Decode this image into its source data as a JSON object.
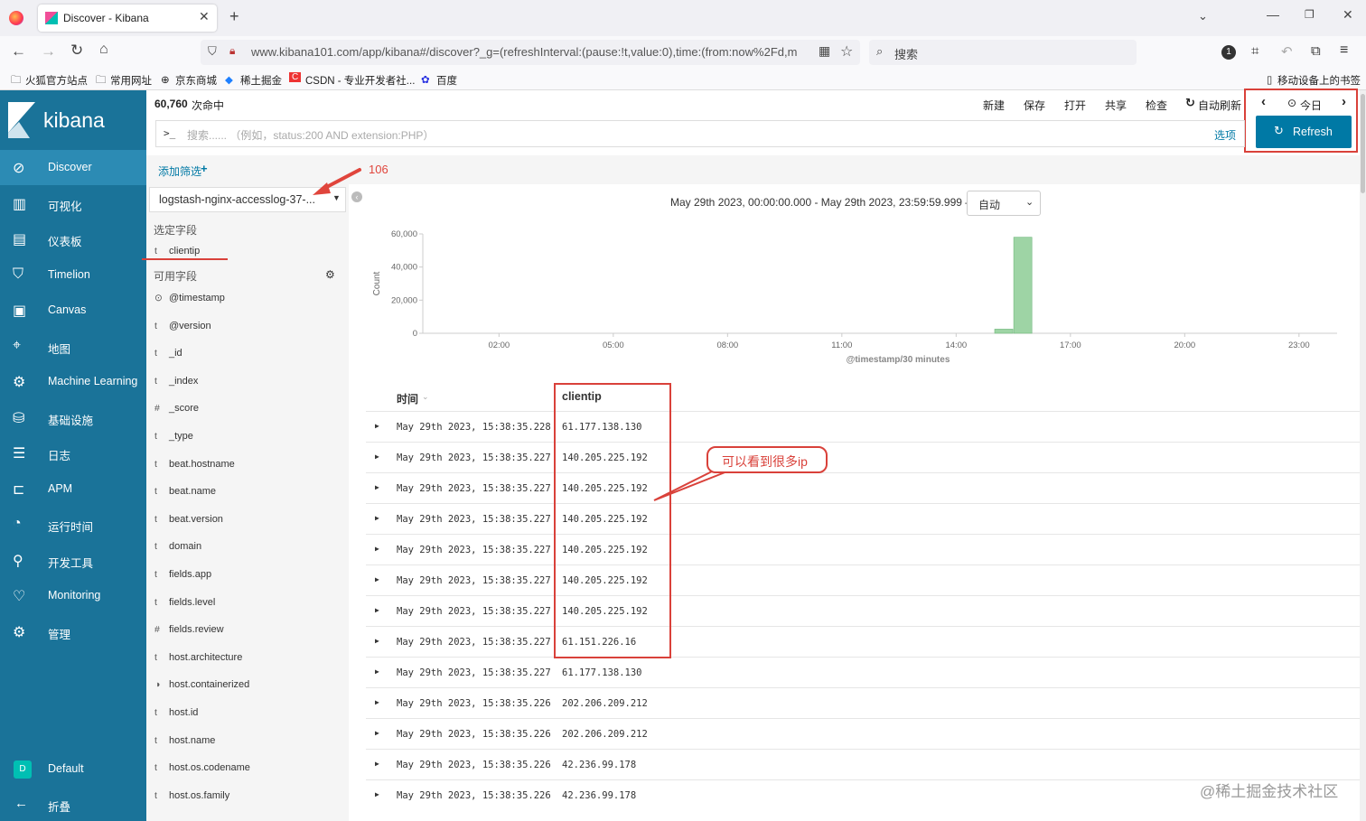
{
  "browser": {
    "tab_title": "Discover - Kibana",
    "url": "www.kibana101.com/app/kibana#/discover?_g=(refreshInterval:(pause:!t,value:0),time:(from:now%2Fd,m",
    "search_placeholder": "搜索",
    "bookmarks": [
      "火狐官方站点",
      "常用网址",
      "京东商城",
      "稀土掘金",
      "CSDN - 专业开发者社...",
      "百度"
    ],
    "mobile_bookmarks": "移动设备上的书签"
  },
  "kibana": {
    "logo_text": "kibana",
    "nav": [
      {
        "label": "Discover",
        "icon": "compass-icon"
      },
      {
        "label": "可视化",
        "icon": "chart-icon"
      },
      {
        "label": "仪表板",
        "icon": "dashboard-icon"
      },
      {
        "label": "Timelion",
        "icon": "shield-icon"
      },
      {
        "label": "Canvas",
        "icon": "canvas-icon"
      },
      {
        "label": "地图",
        "icon": "map-icon"
      },
      {
        "label": "Machine Learning",
        "icon": "ml-icon"
      },
      {
        "label": "基础设施",
        "icon": "infrastructure-icon"
      },
      {
        "label": "日志",
        "icon": "logs-icon"
      },
      {
        "label": "APM",
        "icon": "apm-icon"
      },
      {
        "label": "运行时间",
        "icon": "uptime-icon"
      },
      {
        "label": "开发工具",
        "icon": "wrench-icon"
      },
      {
        "label": "Monitoring",
        "icon": "heartbeat-icon"
      },
      {
        "label": "管理",
        "icon": "gear-icon"
      }
    ],
    "space": {
      "badge": "D",
      "label": "Default"
    },
    "collapse": "折叠",
    "hits_count": "60,760",
    "hits_label": "次命中",
    "top_actions": [
      "新建",
      "保存",
      "打开",
      "共享",
      "检查"
    ],
    "auto_refresh": "自动刷新",
    "today": "今日",
    "query_prompt": ">_",
    "query_placeholder": "搜索...... （例如，status:200 AND extension:PHP）",
    "options": "选项",
    "refresh": "Refresh",
    "add_filter": "添加筛选",
    "index_pattern": "logstash-nginx-accesslog-37-...",
    "selected_fields_title": "选定字段",
    "selected_fields": [
      {
        "type": "t",
        "name": "clientip"
      }
    ],
    "available_fields_title": "可用字段",
    "available_fields": [
      {
        "type": "clock",
        "name": "@timestamp"
      },
      {
        "type": "t",
        "name": "@version"
      },
      {
        "type": "t",
        "name": "_id"
      },
      {
        "type": "t",
        "name": "_index"
      },
      {
        "type": "#",
        "name": "_score"
      },
      {
        "type": "t",
        "name": "_type"
      },
      {
        "type": "t",
        "name": "beat.hostname"
      },
      {
        "type": "t",
        "name": "beat.name"
      },
      {
        "type": "t",
        "name": "beat.version"
      },
      {
        "type": "t",
        "name": "domain"
      },
      {
        "type": "t",
        "name": "fields.app"
      },
      {
        "type": "t",
        "name": "fields.level"
      },
      {
        "type": "#",
        "name": "fields.review"
      },
      {
        "type": "t",
        "name": "host.architecture"
      },
      {
        "type": "half",
        "name": "host.containerized"
      },
      {
        "type": "t",
        "name": "host.id"
      },
      {
        "type": "t",
        "name": "host.name"
      },
      {
        "type": "t",
        "name": "host.os.codename"
      },
      {
        "type": "t",
        "name": "host.os.family"
      }
    ],
    "time_range": "May 29th 2023, 00:00:00.000 - May 29th 2023, 23:59:59.999 —",
    "interval": "自动",
    "table_headers": {
      "time": "时间",
      "clientip": "clientip"
    },
    "rows": [
      {
        "time": "May 29th 2023, 15:38:35.228",
        "clientip": "61.177.138.130"
      },
      {
        "time": "May 29th 2023, 15:38:35.227",
        "clientip": "140.205.225.192"
      },
      {
        "time": "May 29th 2023, 15:38:35.227",
        "clientip": "140.205.225.192"
      },
      {
        "time": "May 29th 2023, 15:38:35.227",
        "clientip": "140.205.225.192"
      },
      {
        "time": "May 29th 2023, 15:38:35.227",
        "clientip": "140.205.225.192"
      },
      {
        "time": "May 29th 2023, 15:38:35.227",
        "clientip": "140.205.225.192"
      },
      {
        "time": "May 29th 2023, 15:38:35.227",
        "clientip": "140.205.225.192"
      },
      {
        "time": "May 29th 2023, 15:38:35.227",
        "clientip": "61.151.226.16"
      },
      {
        "time": "May 29th 2023, 15:38:35.227",
        "clientip": "61.177.138.130"
      },
      {
        "time": "May 29th 2023, 15:38:35.226",
        "clientip": "202.206.209.212"
      },
      {
        "time": "May 29th 2023, 15:38:35.226",
        "clientip": "202.206.209.212"
      },
      {
        "time": "May 29th 2023, 15:38:35.226",
        "clientip": "42.236.99.178"
      },
      {
        "time": "May 29th 2023, 15:38:35.226",
        "clientip": "42.236.99.178"
      }
    ]
  },
  "annotations": {
    "number": "106",
    "callout": "可以看到很多ip",
    "watermark": "@稀土掘金技术社区"
  },
  "chart_data": {
    "type": "bar",
    "ylabel": "Count",
    "xlabel": "@timestamp/30 minutes",
    "y_ticks": [
      "0",
      "20,000",
      "40,000",
      "60,000"
    ],
    "x_ticks": [
      "02:00",
      "05:00",
      "08:00",
      "11:00",
      "14:00",
      "17:00",
      "20:00",
      "23:00"
    ],
    "ylim": [
      0,
      60000
    ],
    "x_range_hours": [
      0,
      24
    ],
    "bars": [
      {
        "start_hour": 15.0,
        "value": 2500
      },
      {
        "start_hour": 15.5,
        "value": 58000
      }
    ],
    "bar_color": "#9ed4a5"
  }
}
